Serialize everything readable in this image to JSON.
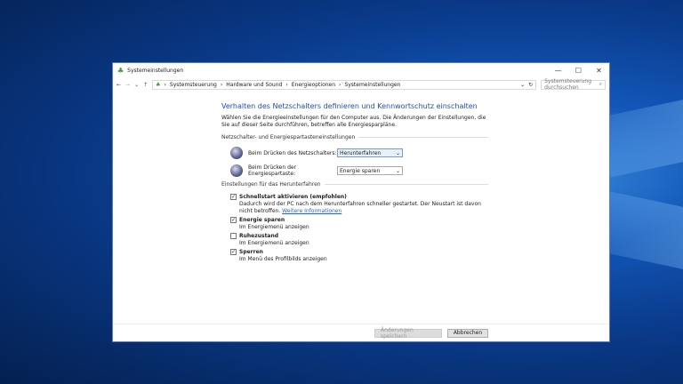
{
  "window": {
    "title": "Systemeinstellungen",
    "minimize": "—",
    "maximize": "☐",
    "close": "✕"
  },
  "nav": {
    "back": "←",
    "forward": "→",
    "recent": "⌄",
    "up": "↑",
    "breadcrumb": [
      "Systemsteuerung",
      "Hardware und Sound",
      "Energieoptionen",
      "Systemeinstellungen"
    ],
    "separator": "›",
    "dropdown": "⌄",
    "refresh": "↻",
    "search_placeholder": "Systemsteuerung durchsuchen",
    "search_icon": "⌕"
  },
  "main": {
    "heading": "Verhalten des Netzschalters definieren und Kennwortschutz einschalten",
    "description": "Wählen Sie die Energieeinstellungen für den Computer aus. Die Änderungen der Einstellungen, die Sie auf dieser Seite durchführen, betreffen alle Energiesparpläne.",
    "section1": "Netzschalter- und Energiespartasteneinstellungen",
    "power_button": {
      "label": "Beim Drücken des Netzschalters:",
      "value": "Herunterfahren"
    },
    "sleep_button": {
      "label": "Beim Drücken der Energiespartaste:",
      "value": "Energie sparen"
    },
    "section2": "Einstellungen für das Herunterfahren",
    "options": [
      {
        "label": "Schnellstart aktivieren (empfohlen)",
        "checked": true,
        "desc": "Dadurch wird der PC nach dem Herunterfahren schneller gestartet. Der Neustart ist davon nicht betroffen.",
        "link": "Weitere Informationen"
      },
      {
        "label": "Energie sparen",
        "checked": true,
        "desc": "Im Energiemenü anzeigen"
      },
      {
        "label": "Ruhezustand",
        "checked": false,
        "desc": "Im Energiemenü anzeigen"
      },
      {
        "label": "Sperren",
        "checked": true,
        "desc": "Im Menü des Profilbilds anzeigen"
      }
    ]
  },
  "footer": {
    "save": "Änderungen speichern",
    "cancel": "Abbrechen"
  },
  "check_mark": "✓"
}
